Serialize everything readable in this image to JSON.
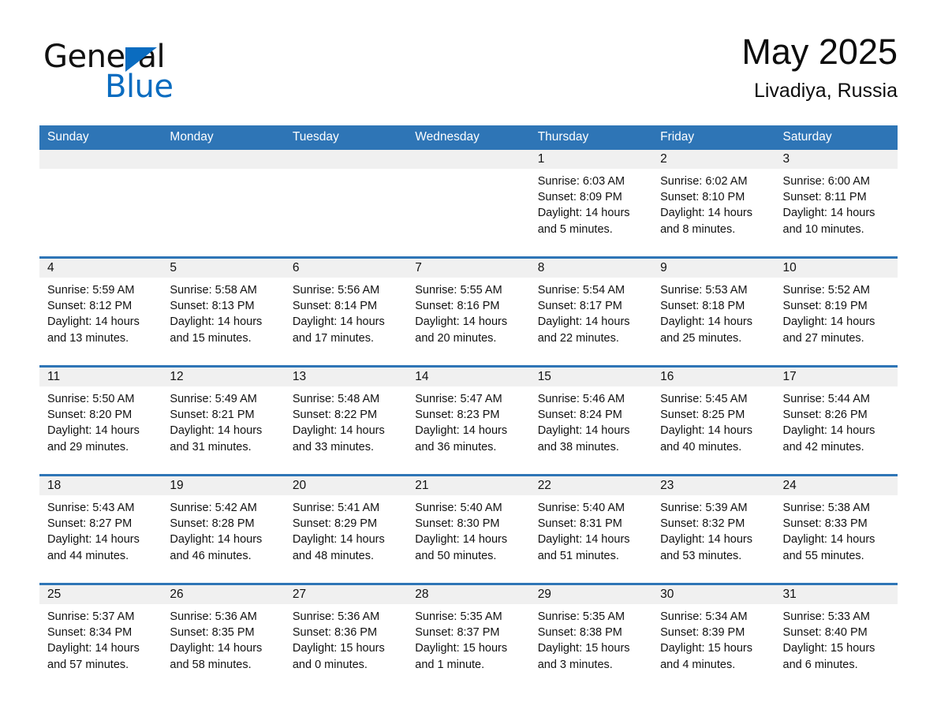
{
  "brand": {
    "word_one": "General",
    "word_two": "Blue",
    "triangle_color": "#0a6cc0"
  },
  "header": {
    "month_title": "May 2025",
    "location": "Livadiya, Russia"
  },
  "theme": {
    "header_blue": "#2e75b6",
    "date_band_gray": "#f0f0f0",
    "text_color": "#111111"
  },
  "weekdays": [
    "Sunday",
    "Monday",
    "Tuesday",
    "Wednesday",
    "Thursday",
    "Friday",
    "Saturday"
  ],
  "weeks": [
    {
      "days": [
        {
          "date": "",
          "sunrise": "",
          "sunset": "",
          "daylight_1": "",
          "daylight_2": ""
        },
        {
          "date": "",
          "sunrise": "",
          "sunset": "",
          "daylight_1": "",
          "daylight_2": ""
        },
        {
          "date": "",
          "sunrise": "",
          "sunset": "",
          "daylight_1": "",
          "daylight_2": ""
        },
        {
          "date": "",
          "sunrise": "",
          "sunset": "",
          "daylight_1": "",
          "daylight_2": ""
        },
        {
          "date": "1",
          "sunrise": "Sunrise: 6:03 AM",
          "sunset": "Sunset: 8:09 PM",
          "daylight_1": "Daylight: 14 hours",
          "daylight_2": "and 5 minutes."
        },
        {
          "date": "2",
          "sunrise": "Sunrise: 6:02 AM",
          "sunset": "Sunset: 8:10 PM",
          "daylight_1": "Daylight: 14 hours",
          "daylight_2": "and 8 minutes."
        },
        {
          "date": "3",
          "sunrise": "Sunrise: 6:00 AM",
          "sunset": "Sunset: 8:11 PM",
          "daylight_1": "Daylight: 14 hours",
          "daylight_2": "and 10 minutes."
        }
      ]
    },
    {
      "days": [
        {
          "date": "4",
          "sunrise": "Sunrise: 5:59 AM",
          "sunset": "Sunset: 8:12 PM",
          "daylight_1": "Daylight: 14 hours",
          "daylight_2": "and 13 minutes."
        },
        {
          "date": "5",
          "sunrise": "Sunrise: 5:58 AM",
          "sunset": "Sunset: 8:13 PM",
          "daylight_1": "Daylight: 14 hours",
          "daylight_2": "and 15 minutes."
        },
        {
          "date": "6",
          "sunrise": "Sunrise: 5:56 AM",
          "sunset": "Sunset: 8:14 PM",
          "daylight_1": "Daylight: 14 hours",
          "daylight_2": "and 17 minutes."
        },
        {
          "date": "7",
          "sunrise": "Sunrise: 5:55 AM",
          "sunset": "Sunset: 8:16 PM",
          "daylight_1": "Daylight: 14 hours",
          "daylight_2": "and 20 minutes."
        },
        {
          "date": "8",
          "sunrise": "Sunrise: 5:54 AM",
          "sunset": "Sunset: 8:17 PM",
          "daylight_1": "Daylight: 14 hours",
          "daylight_2": "and 22 minutes."
        },
        {
          "date": "9",
          "sunrise": "Sunrise: 5:53 AM",
          "sunset": "Sunset: 8:18 PM",
          "daylight_1": "Daylight: 14 hours",
          "daylight_2": "and 25 minutes."
        },
        {
          "date": "10",
          "sunrise": "Sunrise: 5:52 AM",
          "sunset": "Sunset: 8:19 PM",
          "daylight_1": "Daylight: 14 hours",
          "daylight_2": "and 27 minutes."
        }
      ]
    },
    {
      "days": [
        {
          "date": "11",
          "sunrise": "Sunrise: 5:50 AM",
          "sunset": "Sunset: 8:20 PM",
          "daylight_1": "Daylight: 14 hours",
          "daylight_2": "and 29 minutes."
        },
        {
          "date": "12",
          "sunrise": "Sunrise: 5:49 AM",
          "sunset": "Sunset: 8:21 PM",
          "daylight_1": "Daylight: 14 hours",
          "daylight_2": "and 31 minutes."
        },
        {
          "date": "13",
          "sunrise": "Sunrise: 5:48 AM",
          "sunset": "Sunset: 8:22 PM",
          "daylight_1": "Daylight: 14 hours",
          "daylight_2": "and 33 minutes."
        },
        {
          "date": "14",
          "sunrise": "Sunrise: 5:47 AM",
          "sunset": "Sunset: 8:23 PM",
          "daylight_1": "Daylight: 14 hours",
          "daylight_2": "and 36 minutes."
        },
        {
          "date": "15",
          "sunrise": "Sunrise: 5:46 AM",
          "sunset": "Sunset: 8:24 PM",
          "daylight_1": "Daylight: 14 hours",
          "daylight_2": "and 38 minutes."
        },
        {
          "date": "16",
          "sunrise": "Sunrise: 5:45 AM",
          "sunset": "Sunset: 8:25 PM",
          "daylight_1": "Daylight: 14 hours",
          "daylight_2": "and 40 minutes."
        },
        {
          "date": "17",
          "sunrise": "Sunrise: 5:44 AM",
          "sunset": "Sunset: 8:26 PM",
          "daylight_1": "Daylight: 14 hours",
          "daylight_2": "and 42 minutes."
        }
      ]
    },
    {
      "days": [
        {
          "date": "18",
          "sunrise": "Sunrise: 5:43 AM",
          "sunset": "Sunset: 8:27 PM",
          "daylight_1": "Daylight: 14 hours",
          "daylight_2": "and 44 minutes."
        },
        {
          "date": "19",
          "sunrise": "Sunrise: 5:42 AM",
          "sunset": "Sunset: 8:28 PM",
          "daylight_1": "Daylight: 14 hours",
          "daylight_2": "and 46 minutes."
        },
        {
          "date": "20",
          "sunrise": "Sunrise: 5:41 AM",
          "sunset": "Sunset: 8:29 PM",
          "daylight_1": "Daylight: 14 hours",
          "daylight_2": "and 48 minutes."
        },
        {
          "date": "21",
          "sunrise": "Sunrise: 5:40 AM",
          "sunset": "Sunset: 8:30 PM",
          "daylight_1": "Daylight: 14 hours",
          "daylight_2": "and 50 minutes."
        },
        {
          "date": "22",
          "sunrise": "Sunrise: 5:40 AM",
          "sunset": "Sunset: 8:31 PM",
          "daylight_1": "Daylight: 14 hours",
          "daylight_2": "and 51 minutes."
        },
        {
          "date": "23",
          "sunrise": "Sunrise: 5:39 AM",
          "sunset": "Sunset: 8:32 PM",
          "daylight_1": "Daylight: 14 hours",
          "daylight_2": "and 53 minutes."
        },
        {
          "date": "24",
          "sunrise": "Sunrise: 5:38 AM",
          "sunset": "Sunset: 8:33 PM",
          "daylight_1": "Daylight: 14 hours",
          "daylight_2": "and 55 minutes."
        }
      ]
    },
    {
      "days": [
        {
          "date": "25",
          "sunrise": "Sunrise: 5:37 AM",
          "sunset": "Sunset: 8:34 PM",
          "daylight_1": "Daylight: 14 hours",
          "daylight_2": "and 57 minutes."
        },
        {
          "date": "26",
          "sunrise": "Sunrise: 5:36 AM",
          "sunset": "Sunset: 8:35 PM",
          "daylight_1": "Daylight: 14 hours",
          "daylight_2": "and 58 minutes."
        },
        {
          "date": "27",
          "sunrise": "Sunrise: 5:36 AM",
          "sunset": "Sunset: 8:36 PM",
          "daylight_1": "Daylight: 15 hours",
          "daylight_2": "and 0 minutes."
        },
        {
          "date": "28",
          "sunrise": "Sunrise: 5:35 AM",
          "sunset": "Sunset: 8:37 PM",
          "daylight_1": "Daylight: 15 hours",
          "daylight_2": "and 1 minute."
        },
        {
          "date": "29",
          "sunrise": "Sunrise: 5:35 AM",
          "sunset": "Sunset: 8:38 PM",
          "daylight_1": "Daylight: 15 hours",
          "daylight_2": "and 3 minutes."
        },
        {
          "date": "30",
          "sunrise": "Sunrise: 5:34 AM",
          "sunset": "Sunset: 8:39 PM",
          "daylight_1": "Daylight: 15 hours",
          "daylight_2": "and 4 minutes."
        },
        {
          "date": "31",
          "sunrise": "Sunrise: 5:33 AM",
          "sunset": "Sunset: 8:40 PM",
          "daylight_1": "Daylight: 15 hours",
          "daylight_2": "and 6 minutes."
        }
      ]
    }
  ]
}
